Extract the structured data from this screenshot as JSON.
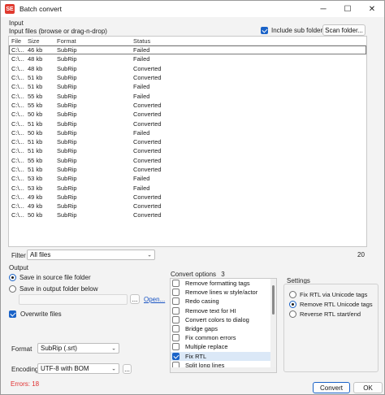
{
  "window": {
    "title": "Batch convert",
    "icon": "app-icon",
    "min": "─",
    "max": "☐",
    "close": "✕"
  },
  "input": {
    "section_label": "Input",
    "files_label": "Input files (browse or drag-n-drop)",
    "include_sub_label": "Include sub folders",
    "include_sub_checked": true,
    "scan_button": "Scan folder...",
    "more_button": "...",
    "columns": [
      "File",
      "Size",
      "Format",
      "Status"
    ],
    "rows": [
      [
        "C:\\...",
        "46 kb",
        "SubRip",
        "Failed"
      ],
      [
        "C:\\...",
        "48 kb",
        "SubRip",
        "Failed"
      ],
      [
        "C:\\...",
        "48 kb",
        "SubRip",
        "Converted"
      ],
      [
        "C:\\...",
        "51 kb",
        "SubRip",
        "Converted"
      ],
      [
        "C:\\...",
        "51 kb",
        "SubRip",
        "Failed"
      ],
      [
        "C:\\...",
        "55 kb",
        "SubRip",
        "Failed"
      ],
      [
        "C:\\...",
        "55 kb",
        "SubRip",
        "Converted"
      ],
      [
        "C:\\...",
        "50 kb",
        "SubRip",
        "Converted"
      ],
      [
        "C:\\...",
        "51 kb",
        "SubRip",
        "Converted"
      ],
      [
        "C:\\...",
        "50 kb",
        "SubRip",
        "Failed"
      ],
      [
        "C:\\...",
        "51 kb",
        "SubRip",
        "Converted"
      ],
      [
        "C:\\...",
        "51 kb",
        "SubRip",
        "Converted"
      ],
      [
        "C:\\...",
        "55 kb",
        "SubRip",
        "Converted"
      ],
      [
        "C:\\...",
        "51 kb",
        "SubRip",
        "Converted"
      ],
      [
        "C:\\...",
        "53 kb",
        "SubRip",
        "Failed"
      ],
      [
        "C:\\...",
        "53 kb",
        "SubRip",
        "Failed"
      ],
      [
        "C:\\...",
        "49 kb",
        "SubRip",
        "Converted"
      ],
      [
        "C:\\...",
        "49 kb",
        "SubRip",
        "Converted"
      ],
      [
        "C:\\...",
        "50 kb",
        "SubRip",
        "Converted"
      ]
    ],
    "filter_label": "Filter",
    "filter_value": "All files",
    "count": "20"
  },
  "output": {
    "section_label": "Output",
    "save_source": "Save in source file folder",
    "save_output": "Save in output folder below",
    "browse_button": "...",
    "open_link": "Open...",
    "overwrite_label": "Overwrite files",
    "format_label": "Format",
    "format_value": "SubRip (.srt)",
    "encoding_label": "Encoding",
    "encoding_value": "UTF-8 with BOM",
    "encoding_more": "..."
  },
  "convert_options": {
    "label": "Convert options",
    "count": "3",
    "items": [
      {
        "label": "Remove formatting tags",
        "checked": false
      },
      {
        "label": "Remove lines w style/actor",
        "checked": false
      },
      {
        "label": "Redo casing",
        "checked": false
      },
      {
        "label": "Remove text for HI",
        "checked": false
      },
      {
        "label": "Convert colors to dialog",
        "checked": false
      },
      {
        "label": "Bridge gaps",
        "checked": false
      },
      {
        "label": "Fix common errors",
        "checked": false
      },
      {
        "label": "Multiple replace",
        "checked": false
      },
      {
        "label": "Fix RTL",
        "checked": true
      },
      {
        "label": "Split long lines",
        "checked": false
      }
    ]
  },
  "settings": {
    "label": "Settings",
    "options": [
      {
        "label": "Fix RTL via Unicode tags",
        "selected": false
      },
      {
        "label": "Remove RTL Unicode tags",
        "selected": true
      },
      {
        "label": "Reverse RTL start/end",
        "selected": false
      }
    ]
  },
  "footer": {
    "errors": "Errors: 18",
    "convert_button": "Convert",
    "ok_button": "OK"
  }
}
